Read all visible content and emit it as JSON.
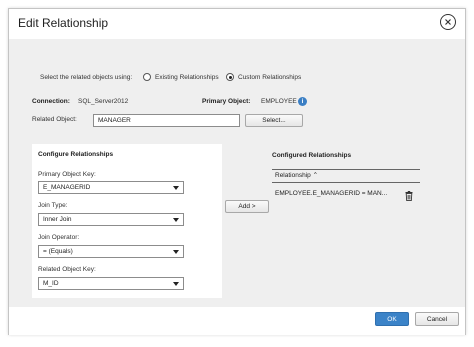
{
  "dialog": {
    "title": "Edit Relationship",
    "close_icon": "close-circle-icon"
  },
  "selection": {
    "prompt": "Select the related objects using:",
    "options": [
      "Existing Relationships",
      "Custom Relationships"
    ],
    "selected": "Custom Relationships"
  },
  "connection": {
    "label": "Connection:",
    "value": "SQL_Server2012"
  },
  "primary_object": {
    "label": "Primary Object:",
    "value": "EMPLOYEE",
    "info_icon": "info-icon"
  },
  "related_object": {
    "label": "Related Object:",
    "value": "MANAGER",
    "select_button": "Select..."
  },
  "configure": {
    "heading": "Configure Relationships",
    "primary_key": {
      "label": "Primary Object Key:",
      "value": "E_MANAGERID"
    },
    "join_type": {
      "label": "Join Type:",
      "value": "Inner Join"
    },
    "join_operator": {
      "label": "Join Operator:",
      "value": "= (Equals)"
    },
    "related_key": {
      "label": "Related Object Key:",
      "value": "M_ID"
    }
  },
  "add_button": "Add >",
  "configured": {
    "heading": "Configured Relationships",
    "column_header": "Relationship ⌃",
    "rows": [
      {
        "text": "EMPLOYEE.E_MANAGERID = MAN...",
        "delete_icon": "trash-icon"
      }
    ]
  },
  "footer": {
    "ok": "OK",
    "cancel": "Cancel"
  }
}
